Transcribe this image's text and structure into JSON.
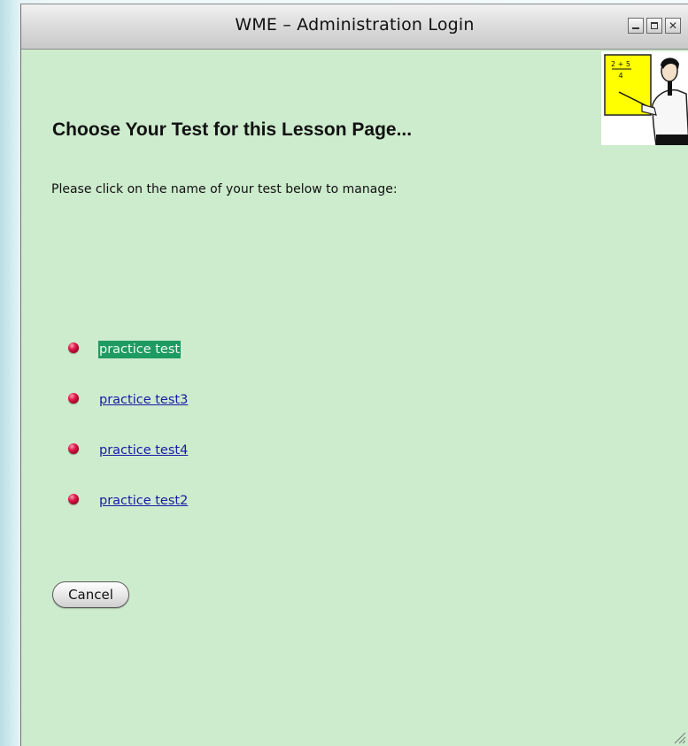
{
  "window": {
    "title": "WME – Administration Login",
    "controls": {
      "minimize_icon": "minimize-icon",
      "maximize_icon": "maximize-icon",
      "close_icon": "close-icon",
      "close_glyph": "✕"
    }
  },
  "header_image": {
    "icon": "teacher-at-blackboard-icon",
    "board_text_top": "2 + 5",
    "board_text_bottom": "4"
  },
  "main": {
    "heading": "Choose Your Test for this Lesson Page...",
    "instructions": "Please click on the name of your test below to manage:",
    "tests": [
      {
        "label": "practice test",
        "selected": true
      },
      {
        "label": "practice test3",
        "selected": false
      },
      {
        "label": "practice test4",
        "selected": false
      },
      {
        "label": "practice test2",
        "selected": false
      }
    ],
    "cancel_label": "Cancel"
  },
  "colors": {
    "window_background": "#cdebcd",
    "link": "#1a1aa6",
    "selected_highlight": "#1e9b62",
    "bullet": "#c8103c"
  }
}
